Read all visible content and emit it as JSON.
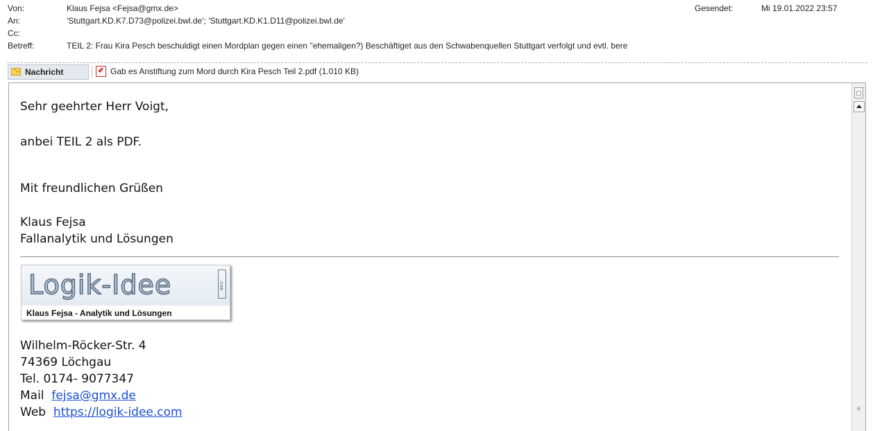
{
  "header": {
    "from_label": "Von:",
    "from_value": "Klaus Fejsa <Fejsa@gmx.de>",
    "to_label": "An:",
    "to_value": "'Stuttgart.KD.K7.D73@polizei.bwl.de'; 'Stuttgart.KD.K1.D11@polizei.bwl.de'",
    "cc_label": "Cc:",
    "cc_value": "",
    "subject_label": "Betreff:",
    "subject_value": "TEIL 2: Frau Kira Pesch beschuldigt einen Mordplan gegen einen \"ehemaligen?) Beschäftiget aus den Schwabenquellen Stuttgart verfolgt und evtl. bere",
    "sent_label": "Gesendet:",
    "sent_value": "Mi 19.01.2022 23:57"
  },
  "tabs": {
    "message_label": "Nachricht",
    "message_icon": "envelope-icon",
    "attachment_icon": "pdf-icon",
    "attachment_label": "Gab es Anstiftung zum Mord durch Kira Pesch Teil 2.pdf (1.010 KB)"
  },
  "body": {
    "greeting": "Sehr geehrter Herr Voigt,",
    "line1": "anbei TEIL 2  als PDF.",
    "closing": "Mit freundlichen Grüßen",
    "sig_name": "Klaus Fejsa",
    "sig_title": "Fallanalytik und Lösungen",
    "logo_text": "Logik-Idee",
    "logo_com": ".com",
    "logo_sub": "Klaus Fejsa  -  Analytik und Lösungen",
    "street": "Wilhelm-Röcker-Str.  4",
    "city": "74369 Löchgau",
    "tel": "Tel.  0174- 9077347",
    "mail_label": "Mail",
    "mail_link": "fejsa@gmx.de",
    "web_label": "Web",
    "web_link": "https://logik-idee.com"
  },
  "colors": {
    "link": "#1a4fd6",
    "pdf_red": "#d0302a",
    "envelope": "#f5d45a"
  }
}
